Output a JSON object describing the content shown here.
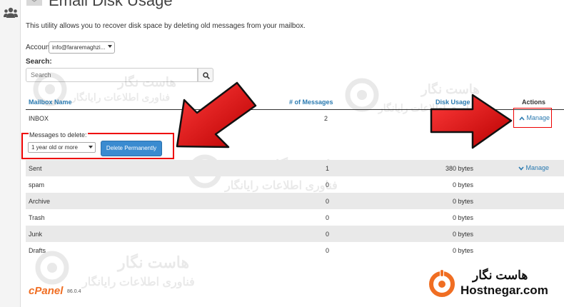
{
  "page": {
    "title": "Email Disk Usage",
    "description": "This utility allows you to recover disk space by deleting old messages from your mailbox."
  },
  "account": {
    "label": "Account:",
    "selected": "info@fararemaghzi..."
  },
  "search": {
    "label": "Search:",
    "placeholder": "Search"
  },
  "table": {
    "headers": {
      "mailbox": "Mailbox Name",
      "messages": "# of Messages",
      "usage": "Disk Usage ▼",
      "actions": "Actions"
    },
    "inbox": {
      "name": "INBOX",
      "count": "2",
      "action": "Manage"
    },
    "delete_panel": {
      "label": "Messages to delete:",
      "selected_age": "1 year old or more",
      "button": "Delete Permanently"
    },
    "rows": [
      {
        "name": "Sent",
        "count": "1",
        "size": "380 bytes",
        "action": "Manage"
      },
      {
        "name": "spam",
        "count": "0",
        "size": "0 bytes"
      },
      {
        "name": "Archive",
        "count": "0",
        "size": "0 bytes"
      },
      {
        "name": "Trash",
        "count": "0",
        "size": "0 bytes"
      },
      {
        "name": "Junk",
        "count": "0",
        "size": "0 bytes"
      },
      {
        "name": "Drafts",
        "count": "0",
        "size": "0 bytes"
      }
    ]
  },
  "footer": {
    "logo": "cPanel",
    "version": "86.0.4"
  },
  "branding": {
    "name_fa": "هاست نگار",
    "name_en": "Hostnegar.com",
    "watermark_fa_1": "هاست نگار",
    "watermark_fa_2": "فناوری اطلاعات رایانگار"
  },
  "colors": {
    "link": "#2a7ab0",
    "button": "#3a8bd0",
    "highlight": "#e00000",
    "arrow": "#dd1111",
    "cpanel": "#f06e23"
  },
  "icons": {
    "left_rail": "users-icon",
    "search": "search-icon",
    "manage": "chevron-up-icon",
    "manage_collapsed": "chevron-down-icon"
  }
}
